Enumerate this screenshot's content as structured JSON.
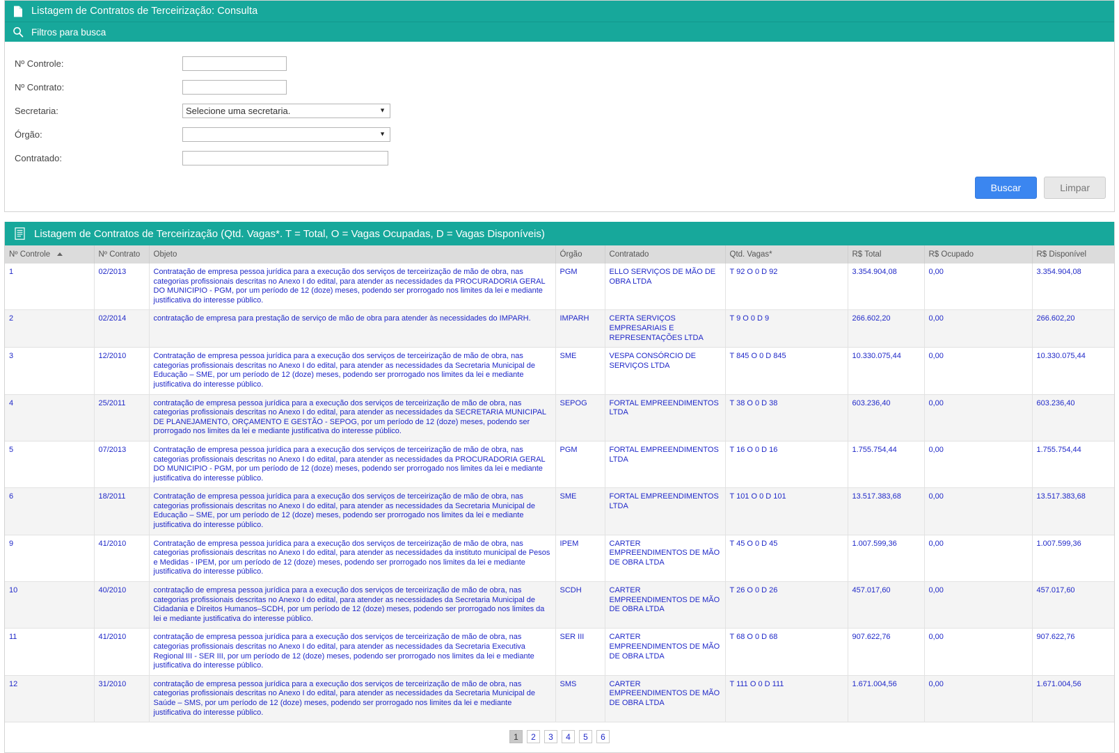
{
  "header": {
    "title": "Listagem de Contratos de Terceirização: Consulta",
    "subtitle": "Filtros para busca",
    "title_icon": "document-icon",
    "subtitle_icon": "search-icon"
  },
  "filters": {
    "fields": [
      {
        "label": "Nº Controle:",
        "value": "",
        "placeholder": "",
        "type": "text"
      },
      {
        "label": "Nº Contrato:",
        "value": "",
        "placeholder": "",
        "type": "text"
      },
      {
        "label": "Secretaria:",
        "value": "Selecione uma secretaria.",
        "type": "select"
      },
      {
        "label": "Órgão:",
        "value": "",
        "type": "select"
      },
      {
        "label": "Contratado:",
        "value": "",
        "placeholder": "",
        "type": "text"
      }
    ],
    "search_button": "Buscar",
    "clear_button": "Limpar",
    "search_button_color": "#3b86f0"
  },
  "results": {
    "title": "Listagem de Contratos de Terceirização (Qtd. Vagas*. T = Total, O = Vagas Ocupadas, D = Vagas Disponíveis)",
    "title_icon": "list-icon",
    "sorted_column": "Nº Controle",
    "sort_direction": "asc",
    "columns": [
      "Nº Controle",
      "Nº Contrato",
      "Objeto",
      "Órgão",
      "Contratado",
      "Qtd. Vagas*",
      "R$ Total",
      "R$ Ocupado",
      "R$ Disponível"
    ],
    "rows": [
      {
        "controle": "1",
        "contrato": "02/2013",
        "objeto": "Contratação de empresa pessoa jurídica para a execução dos serviços de terceirização de mão de obra, nas categorias profissionais descritas no Anexo I do edital, para atender as necessidades da PROCURADORIA GERAL DO MUNICIPIO - PGM, por um período de 12 (doze) meses, podendo ser prorrogado nos limites da lei e mediante justificativa do interesse público.",
        "orgao": "PGM",
        "contratado": "ELLO SERVIÇOS DE MÃO DE OBRA LTDA",
        "vagas": "T 92 O 0 D 92",
        "total": "3.354.904,08",
        "ocupado": "0,00",
        "disponivel": "3.354.904,08"
      },
      {
        "controle": "2",
        "contrato": "02/2014",
        "objeto": "contratação de empresa para prestação de serviço de mão de obra para atender às necessidades do IMPARH.",
        "orgao": "IMPARH",
        "contratado": "CERTA SERVIÇOS EMPRESARIAIS E REPRESENTAÇÕES LTDA",
        "vagas": "T 9 O 0 D 9",
        "total": "266.602,20",
        "ocupado": "0,00",
        "disponivel": "266.602,20"
      },
      {
        "controle": "3",
        "contrato": "12/2010",
        "objeto": "Contratação de empresa pessoa jurídica para a execução dos serviços de terceirização de mão de obra, nas categorias profissionais descritas no Anexo I do edital, para atender as necessidades da Secretaria Municipal de Educação – SME, por um período de 12 (doze) meses, podendo ser prorrogado nos limites da lei e mediante justificativa do interesse público.",
        "orgao": "SME",
        "contratado": "VESPA CONSÓRCIO DE SERVIÇOS LTDA",
        "vagas": "T 845 O 0 D 845",
        "total": "10.330.075,44",
        "ocupado": "0,00",
        "disponivel": "10.330.075,44"
      },
      {
        "controle": "4",
        "contrato": "25/2011",
        "objeto": "contratação de empresa pessoa jurídica para a execução dos serviços de terceirização de mão de obra, nas categorias profissionais descritas no Anexo I do edital, para atender as necessidades da SECRETARIA MUNICIPAL DE PLANEJAMENTO, ORÇAMENTO E GESTÃO - SEPOG, por um período de 12 (doze) meses, podendo ser prorrogado nos limites da lei e mediante justificativa do interesse público.",
        "orgao": "SEPOG",
        "contratado": "FORTAL EMPREENDIMENTOS LTDA",
        "vagas": "T 38 O 0 D 38",
        "total": "603.236,40",
        "ocupado": "0,00",
        "disponivel": "603.236,40"
      },
      {
        "controle": "5",
        "contrato": "07/2013",
        "objeto": "Contratação de empresa pessoa jurídica para a execução dos serviços de terceirização de mão de obra, nas categorias profissionais descritas no Anexo I do edital, para atender as necessidades da PROCURADORIA GERAL DO MUNICIPIO - PGM, por um período de 12 (doze) meses, podendo ser prorrogado nos limites da lei e mediante justificativa do interesse público.",
        "orgao": "PGM",
        "contratado": "FORTAL EMPREENDIMENTOS LTDA",
        "vagas": "T 16 O 0 D 16",
        "total": "1.755.754,44",
        "ocupado": "0,00",
        "disponivel": "1.755.754,44"
      },
      {
        "controle": "6",
        "contrato": "18/2011",
        "objeto": "Contratação de empresa pessoa jurídica para a execução dos serviços de terceirização de mão de obra, nas categorias profissionais descritas no Anexo I do edital, para atender as necessidades da Secretaria Municipal de Educação – SME, por um período de 12 (doze) meses, podendo ser prorrogado nos limites da lei e mediante justificativa do interesse público.",
        "orgao": "SME",
        "contratado": "FORTAL EMPREENDIMENTOS LTDA",
        "vagas": "T 101 O 0 D 101",
        "total": "13.517.383,68",
        "ocupado": "0,00",
        "disponivel": "13.517.383,68"
      },
      {
        "controle": "9",
        "contrato": "41/2010",
        "objeto": "Contratação de empresa pessoa jurídica para a execução dos serviços de terceirização de mão de obra, nas categorias profissionais descritas no Anexo I do edital, para atender as necessidades da instituto municipal de Pesos e Medidas - IPEM, por um período de 12 (doze) meses, podendo ser prorrogado nos limites da lei e mediante justificativa do interesse público.",
        "orgao": "IPEM",
        "contratado": "CARTER EMPREENDIMENTOS DE MÃO DE OBRA LTDA",
        "vagas": "T 45 O 0 D 45",
        "total": "1.007.599,36",
        "ocupado": "0,00",
        "disponivel": "1.007.599,36"
      },
      {
        "controle": "10",
        "contrato": "40/2010",
        "objeto": "contratação de empresa pessoa jurídica para a execução dos serviços de terceirização de mão de obra, nas categorias profissionais descritas no Anexo I do edital, para atender as necessidades da Secretaria Municipal de Cidadania e Direitos Humanos–SCDH, por um período de 12 (doze) meses, podendo ser prorrogado nos limites da lei e mediante justificativa do interesse público.",
        "orgao": "SCDH",
        "contratado": "CARTER EMPREENDIMENTOS DE MÃO DE OBRA LTDA",
        "vagas": "T 26 O 0 D 26",
        "total": "457.017,60",
        "ocupado": "0,00",
        "disponivel": "457.017,60"
      },
      {
        "controle": "11",
        "contrato": "41/2010",
        "objeto": "contratação de empresa pessoa jurídica para a execução dos serviços de terceirização de mão de obra, nas categorias profissionais descritas no Anexo I do edital, para atender as necessidades da Secretaria Executiva Regional III - SER III, por um período de 12 (doze) meses, podendo ser prorrogado nos limites da lei e mediante justificativa do interesse público.",
        "orgao": "SER III",
        "contratado": "CARTER EMPREENDIMENTOS DE MÃO DE OBRA LTDA",
        "vagas": "T 68 O 0 D 68",
        "total": "907.622,76",
        "ocupado": "0,00",
        "disponivel": "907.622,76"
      },
      {
        "controle": "12",
        "contrato": "31/2010",
        "objeto": "contratação de empresa pessoa jurídica para a execução dos serviços de terceirização de mão de obra, nas categorias profissionais descritas no Anexo I do edital, para atender as necessidades da Secretaria Municipal de Saúde – SMS, por um período de 12 (doze) meses, podendo ser prorrogado nos limites da lei e mediante justificativa do interesse público.",
        "orgao": "SMS",
        "contratado": "CARTER EMPREENDIMENTOS DE MÃO DE OBRA LTDA",
        "vagas": "T 111 O 0 D 111",
        "total": "1.671.004,56",
        "ocupado": "0,00",
        "disponivel": "1.671.004,56"
      }
    ]
  },
  "pagination": {
    "pages": [
      "1",
      "2",
      "3",
      "4",
      "5",
      "6"
    ],
    "current": "1"
  },
  "theme": {
    "teal": "#17a89b",
    "link_blue": "#1f28c8",
    "header_gray": "#dcdcdc"
  }
}
